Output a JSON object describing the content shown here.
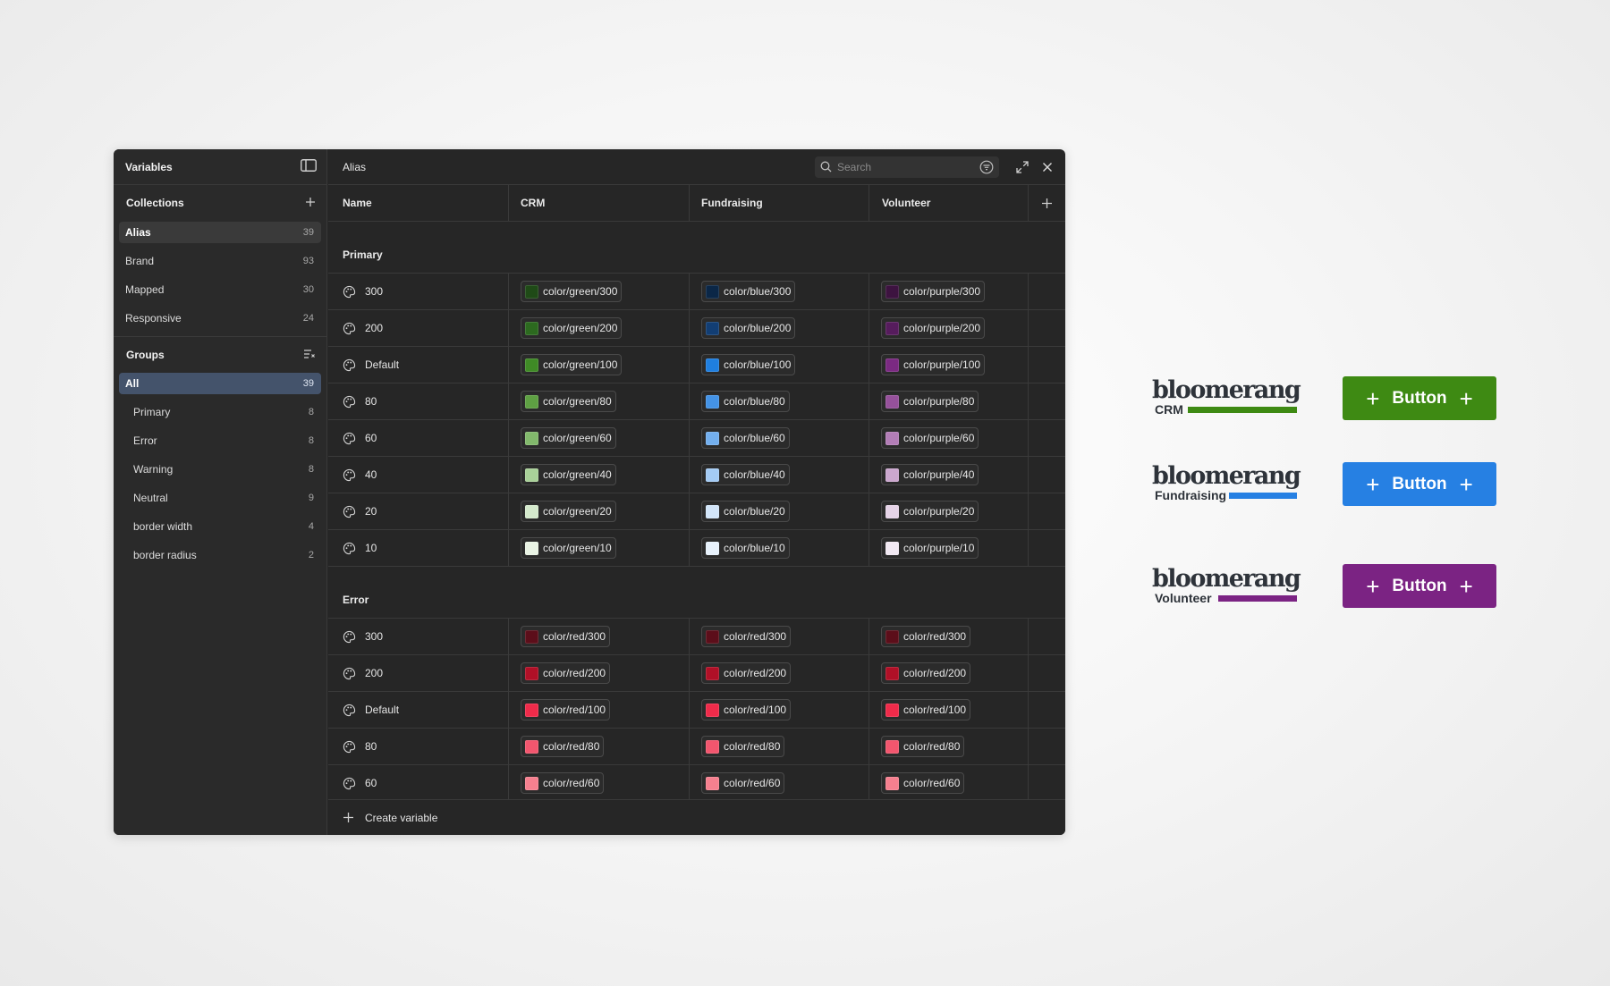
{
  "sidebar": {
    "title": "Variables",
    "collections_label": "Collections",
    "collections": [
      {
        "label": "Alias",
        "count": "39"
      },
      {
        "label": "Brand",
        "count": "93"
      },
      {
        "label": "Mapped",
        "count": "30"
      },
      {
        "label": "Responsive",
        "count": "24"
      }
    ],
    "groups_label": "Groups",
    "groups": [
      {
        "label": "All",
        "count": "39"
      },
      {
        "label": "Primary",
        "count": "8"
      },
      {
        "label": "Error",
        "count": "8"
      },
      {
        "label": "Warning",
        "count": "8"
      },
      {
        "label": "Neutral",
        "count": "9"
      },
      {
        "label": "border width",
        "count": "4"
      },
      {
        "label": "border radius",
        "count": "2"
      }
    ]
  },
  "main": {
    "title": "Alias",
    "search_placeholder": "Search",
    "columns": [
      "Name",
      "CRM",
      "Fundraising",
      "Volunteer"
    ],
    "groups": [
      {
        "title": "Primary",
        "rows": [
          {
            "name": "300",
            "crm": {
              "label": "color/green/300",
              "color": "#1f4a17"
            },
            "fund": {
              "label": "color/blue/300",
              "color": "#0b2747"
            },
            "vol": {
              "label": "color/purple/300",
              "color": "#3d1340"
            }
          },
          {
            "name": "200",
            "crm": {
              "label": "color/green/200",
              "color": "#2c6a1f"
            },
            "fund": {
              "label": "color/blue/200",
              "color": "#123e74"
            },
            "vol": {
              "label": "color/purple/200",
              "color": "#561c5d"
            }
          },
          {
            "name": "Default",
            "crm": {
              "label": "color/green/100",
              "color": "#3f8a26"
            },
            "fund": {
              "label": "color/blue/100",
              "color": "#1f7fe0"
            },
            "vol": {
              "label": "color/purple/100",
              "color": "#7b2a82"
            }
          },
          {
            "name": "80",
            "crm": {
              "label": "color/green/80",
              "color": "#5ea043"
            },
            "fund": {
              "label": "color/blue/80",
              "color": "#4493e6"
            },
            "vol": {
              "label": "color/purple/80",
              "color": "#96519b"
            }
          },
          {
            "name": "60",
            "crm": {
              "label": "color/green/60",
              "color": "#82b96c"
            },
            "fund": {
              "label": "color/blue/60",
              "color": "#73afee"
            },
            "vol": {
              "label": "color/purple/60",
              "color": "#b27db6"
            }
          },
          {
            "name": "40",
            "crm": {
              "label": "color/green/40",
              "color": "#a9d199"
            },
            "fund": {
              "label": "color/blue/40",
              "color": "#a4cbf4"
            },
            "vol": {
              "label": "color/purple/40",
              "color": "#cba7ce"
            }
          },
          {
            "name": "20",
            "crm": {
              "label": "color/green/20",
              "color": "#d4e9cc"
            },
            "fund": {
              "label": "color/blue/20",
              "color": "#d2e5f9"
            },
            "vol": {
              "label": "color/purple/20",
              "color": "#e5d3e7"
            }
          },
          {
            "name": "10",
            "crm": {
              "label": "color/green/10",
              "color": "#eaf4e5"
            },
            "fund": {
              "label": "color/blue/10",
              "color": "#e8f2fc"
            },
            "vol": {
              "label": "color/purple/10",
              "color": "#f2e9f3"
            }
          }
        ]
      },
      {
        "title": "Error",
        "rows": [
          {
            "name": "300",
            "crm": {
              "label": "color/red/300",
              "color": "#5c0e1a"
            },
            "fund": {
              "label": "color/red/300",
              "color": "#5c0e1a"
            },
            "vol": {
              "label": "color/red/300",
              "color": "#5c0e1a"
            }
          },
          {
            "name": "200",
            "crm": {
              "label": "color/red/200",
              "color": "#b01027"
            },
            "fund": {
              "label": "color/red/200",
              "color": "#b01027"
            },
            "vol": {
              "label": "color/red/200",
              "color": "#b01027"
            }
          },
          {
            "name": "Default",
            "crm": {
              "label": "color/red/100",
              "color": "#ef2b4a"
            },
            "fund": {
              "label": "color/red/100",
              "color": "#ef2b4a"
            },
            "vol": {
              "label": "color/red/100",
              "color": "#ef2b4a"
            }
          },
          {
            "name": "80",
            "crm": {
              "label": "color/red/80",
              "color": "#f2566e"
            },
            "fund": {
              "label": "color/red/80",
              "color": "#f2566e"
            },
            "vol": {
              "label": "color/red/80",
              "color": "#f2566e"
            }
          },
          {
            "name": "60",
            "crm": {
              "label": "color/red/60",
              "color": "#f5808f"
            },
            "fund": {
              "label": "color/red/60",
              "color": "#f5808f"
            },
            "vol": {
              "label": "color/red/60",
              "color": "#f5808f"
            }
          }
        ]
      }
    ],
    "create_label": "Create variable"
  },
  "brands": [
    {
      "word": "bloomerang",
      "sub": "CRM",
      "color": "#3e8a13",
      "button_label": "Button"
    },
    {
      "word": "bloomerang",
      "sub": "Fundraising",
      "color": "#2680e3",
      "button_label": "Button"
    },
    {
      "word": "bloomerang",
      "sub": "Volunteer",
      "color": "#7b2383",
      "button_label": "Button"
    }
  ]
}
